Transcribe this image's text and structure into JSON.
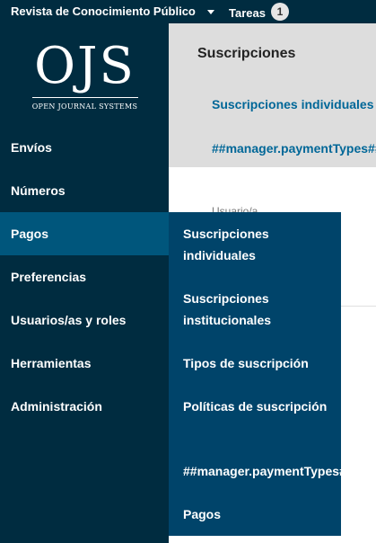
{
  "topbar": {
    "journal_name": "Revista de Conocimiento Público",
    "tasks_label": "Tareas",
    "tasks_count": "1"
  },
  "logo": {
    "wordmark": "OJS",
    "subtitle": "OPEN JOURNAL SYSTEMS"
  },
  "sidebar": {
    "items": [
      {
        "label": "Envíos"
      },
      {
        "label": "Números"
      },
      {
        "label": "Pagos"
      },
      {
        "label": "Preferencias"
      },
      {
        "label": "Usuarios/as y roles"
      },
      {
        "label": "Herramientas"
      },
      {
        "label": "Administración"
      }
    ],
    "active": "Pagos"
  },
  "header": {
    "title": "Suscripciones",
    "tabs": [
      {
        "label": "Suscripciones individuales"
      },
      {
        "label": "##manager.paymentTypes##"
      }
    ]
  },
  "main": {
    "column_label": "Usuario/a"
  },
  "submenu": {
    "items": [
      {
        "label": "Suscripciones individuales"
      },
      {
        "label": "Suscripciones institucionales"
      },
      {
        "label": "Tipos de suscripción"
      },
      {
        "label": "Políticas de suscripción"
      },
      {
        "label": "##manager.paymentTypes##"
      },
      {
        "label": "Pagos"
      }
    ]
  }
}
